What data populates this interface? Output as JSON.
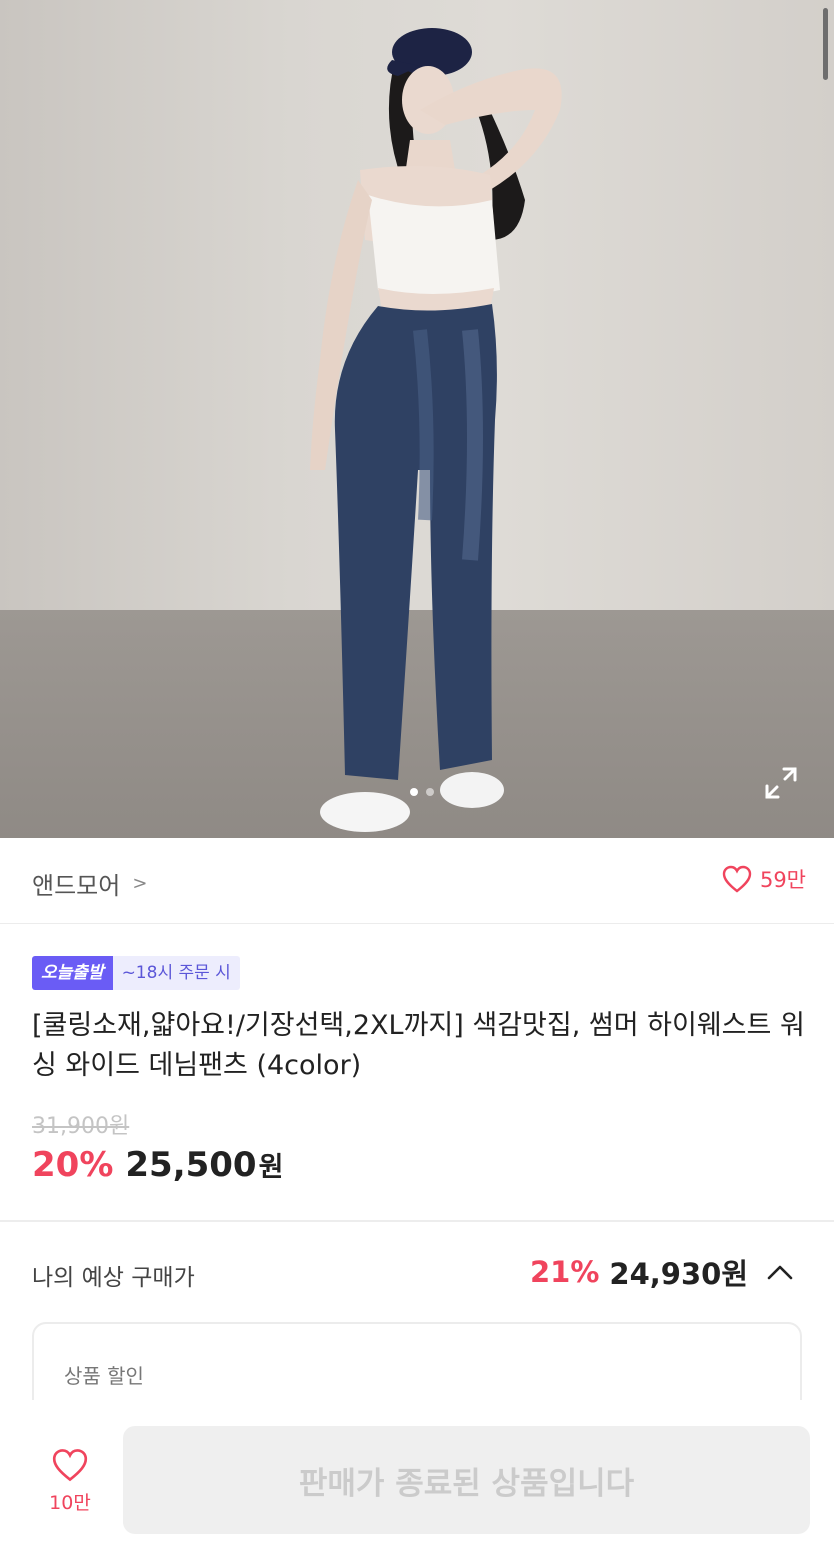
{
  "product_image": {
    "alt": "",
    "expand_icon": "expand-icon",
    "carousel_dots": 2,
    "active_dot": 1
  },
  "brand": {
    "name": "앤드모어",
    "chevron": ">"
  },
  "like_mini": {
    "icon": "heart-outline-icon",
    "count": "59만"
  },
  "badges": {
    "today": "오늘출발",
    "deadline": "~18시 주문 시"
  },
  "title": "[쿨링소재,얇아요!/기장선택,2XL까지] 색감맛집, 썸머 하이웨스트 워싱 와이드 데님팬츠 (4color)",
  "pricing": {
    "original": "31,900원",
    "discount_pct": "20%",
    "price": "25,500",
    "currency": "원"
  },
  "expected_price": {
    "label": "나의 예상 구매가",
    "discount_pct": "21%",
    "amount": "24,930원",
    "caret_icon": "chevron-up-icon"
  },
  "discount_section": {
    "label": "상품 할인"
  },
  "bottom_bar": {
    "like_icon": "heart-outline-icon",
    "like_count": "10만",
    "buy_button_label": "판매가 종료된 상품입니다"
  },
  "colors": {
    "accent_red": "#f0445d",
    "badge_purple": "#6a5cf5",
    "badge_sub_bg": "#ededfd",
    "disabled_bg": "#efefef",
    "disabled_text": "#cbcbcb"
  }
}
